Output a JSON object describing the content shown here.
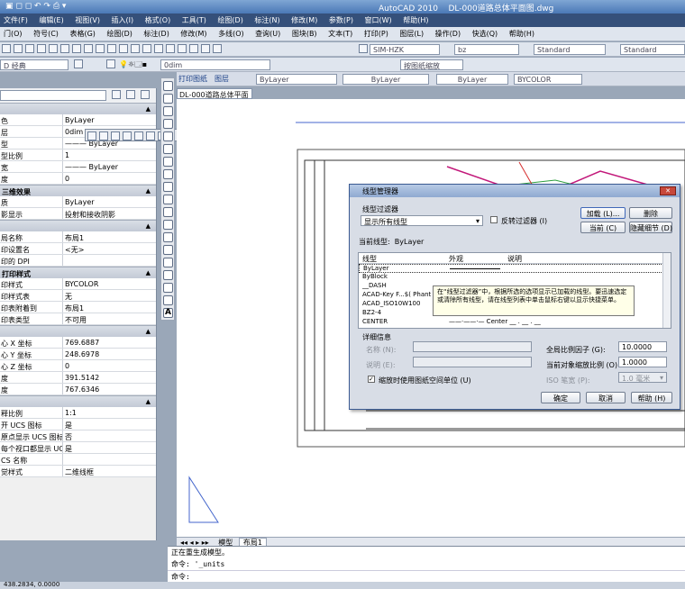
{
  "window": {
    "app": "AutoCAD 2010",
    "file": "DL-000道路总体平面图.dwg"
  },
  "menubar": [
    "文件(F)",
    "编辑(E)",
    "视图(V)",
    "插入(I)",
    "格式(O)",
    "工具(T)",
    "绘图(D)",
    "标注(N)",
    "修改(M)",
    "参数(P)",
    "窗口(W)",
    "帮助(H)"
  ],
  "menubar2": [
    "门(O)",
    "符号(C)",
    "表格(G)",
    "绘图(D)",
    "标注(D)",
    "修改(M)",
    "多线(O)",
    "查询(U)",
    "图块(B)",
    "文本(T)",
    "打印(P)",
    "图层(L)",
    "操作(D)",
    "快选(Q)",
    "帮助(H)"
  ],
  "toolbar": {
    "textstyle": "SIM-HZK",
    "textfont": "bz",
    "dimstyle": "Standard",
    "tablestyle": "Standard",
    "workspace": "D 经典",
    "dimstyle2": "0dim",
    "viewcombo": "按图纸缩放"
  },
  "layer_bar": {
    "tab1": "打印图纸",
    "tab2": "图层",
    "color": "ByLayer",
    "linetype": "ByLayer",
    "lineweight": "ByLayer",
    "plotstyle": "BYCOLOR"
  },
  "drawing_tab": "DL-000道路总体平面图",
  "props": {
    "general": [
      {
        "k": "色",
        "v": "ByLayer"
      },
      {
        "k": "层",
        "v": "0dim"
      },
      {
        "k": "型",
        "v": "——— ByLayer"
      },
      {
        "k": "型比例",
        "v": "1"
      },
      {
        "k": "宽",
        "v": "——— ByLayer"
      },
      {
        "k": "度",
        "v": "0"
      }
    ],
    "s3d": "三维效果",
    "s3d_rows": [
      {
        "k": "质",
        "v": "ByLayer"
      },
      {
        "k": "影显示",
        "v": "投射和接收阴影"
      }
    ],
    "plot": [
      {
        "k": "局名称",
        "v": "布局1"
      },
      {
        "k": "印设置名",
        "v": "<无>"
      },
      {
        "k": "印的 DPI",
        "v": ""
      }
    ],
    "pstyle": "打印样式",
    "pstyle_rows": [
      {
        "k": "印样式",
        "v": "BYCOLOR"
      },
      {
        "k": "印样式表",
        "v": "无"
      },
      {
        "k": "印表附着到",
        "v": "布局1"
      },
      {
        "k": "印表类型",
        "v": "不可用"
      }
    ],
    "view": [
      {
        "k": "心 X 坐标",
        "v": "769.6887"
      },
      {
        "k": "心 Y 坐标",
        "v": "248.6978"
      },
      {
        "k": "心 Z 坐标",
        "v": "0"
      },
      {
        "k": "度",
        "v": "391.5142"
      },
      {
        "k": "度",
        "v": "767.6346"
      }
    ],
    "misc": [
      {
        "k": "释比例",
        "v": "1:1"
      },
      {
        "k": "开 UCS 图标",
        "v": "是"
      },
      {
        "k": "原点显示 UCS 图标",
        "v": "否"
      },
      {
        "k": "每个视口都显示 UCS",
        "v": "是"
      },
      {
        "k": "CS 名称",
        "v": ""
      },
      {
        "k": "觉样式",
        "v": "二维线框"
      }
    ]
  },
  "dialog": {
    "title": "线型管理器",
    "filter_label": "线型过滤器",
    "filter_value": "显示所有线型",
    "invert": "反转过滤器 (I)",
    "load": "加载 (L)...",
    "delete": "删除",
    "current": "当前 (C)",
    "hide_details": "隐藏细节 (D)",
    "current_lt_label": "当前线型:",
    "current_lt": "ByLayer",
    "col_lt": "线型",
    "col_look": "外观",
    "col_desc": "说明",
    "items": [
      "ByLayer",
      "ByBlock",
      "__DASH",
      "ACAD-Key F...$( Phant",
      "ACAD_ISO10W100",
      "BZ2-4",
      "CENTER"
    ],
    "tooltip": "在“线型过滤器”中，根据所选的选项显示已加载的线型。要迅速选定或清除所有线型，请在线型列表中单击鼠标右键以显示快捷菜单。",
    "center_desc": "Center",
    "details": "详细信息",
    "name_label": "名称 (N):",
    "desc_label": "说明 (E):",
    "global_scale_label": "全局比例因子 (G):",
    "global_scale": "10.0000",
    "obj_scale_label": "当前对象缩放比例 (O):",
    "obj_scale": "1.0000",
    "iso_label": "ISO 笔宽 (P):",
    "iso": "1.0 毫米",
    "paper_units": "缩放时使用图纸空间单位 (U)",
    "ok": "确定",
    "cancel": "取消",
    "help": "帮助 (H)"
  },
  "layout_tabs": [
    "模型",
    "布局1"
  ],
  "command": {
    "line1": "正在重生成模型。",
    "line2": "命令: '_units",
    "line3": "命令:"
  },
  "status_coord": "438.2834, 0.0000"
}
